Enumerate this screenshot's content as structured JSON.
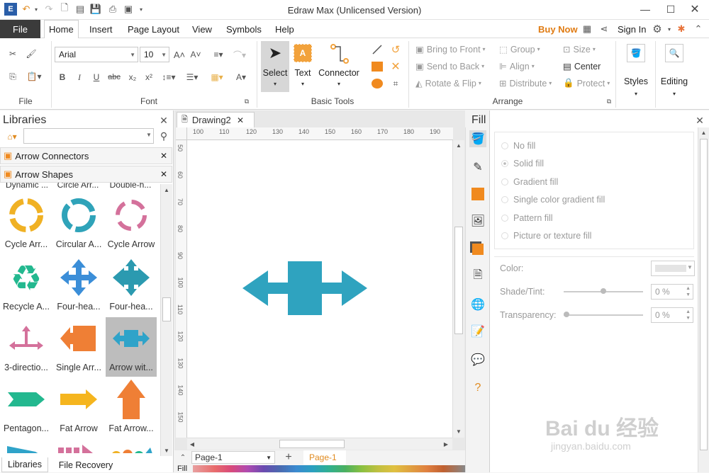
{
  "window": {
    "title": "Edraw Max (Unlicensed Version)"
  },
  "menu": {
    "file": "File",
    "tabs": [
      "Home",
      "Insert",
      "Page Layout",
      "View",
      "Symbols",
      "Help"
    ],
    "buy_now": "Buy Now",
    "sign_in": "Sign In"
  },
  "ribbon": {
    "file_group": "File",
    "font": {
      "name": "Arial",
      "size": "10",
      "group": "Font"
    },
    "basic_tools": {
      "select": "Select",
      "text": "Text",
      "connector": "Connector",
      "group": "Basic Tools"
    },
    "arrange": {
      "bring_to_front": "Bring to Front",
      "send_to_back": "Send to Back",
      "rotate_flip": "Rotate & Flip",
      "group": "Group",
      "align": "Align",
      "distribute": "Distribute",
      "size": "Size",
      "center": "Center",
      "protect": "Protect",
      "label": "Arrange"
    },
    "styles": "Styles",
    "editing": "Editing"
  },
  "libraries": {
    "title": "Libraries",
    "search_placeholder": "",
    "sections": [
      "Arrow Connectors",
      "Arrow Shapes"
    ],
    "cut_labels": [
      "Dynamic ...",
      "Circle Arr...",
      "Double-h..."
    ],
    "shapes": [
      {
        "label": "Cycle Arr...",
        "color": "#f0b124"
      },
      {
        "label": "Circular A...",
        "color": "#2fa3b9"
      },
      {
        "label": "Cycle Arrow",
        "color": "#d4719b"
      },
      {
        "label": "Recycle A...",
        "color": "#23b88f"
      },
      {
        "label": "Four-hea...",
        "color": "#3b8ed8"
      },
      {
        "label": "Four-hea...",
        "color": "#2b9ab0"
      },
      {
        "label": "3-directio...",
        "color": "#d4719b"
      },
      {
        "label": "Single Arr...",
        "color": "#ef7f35"
      },
      {
        "label": "Arrow wit...",
        "color": "#2fa3c9"
      },
      {
        "label": "Pentagon...",
        "color": "#23b88f"
      },
      {
        "label": "Fat Arrow",
        "color": "#f5b51e"
      },
      {
        "label": "Fat Arrow...",
        "color": "#ef7f35"
      }
    ]
  },
  "document": {
    "tab": "Drawing2",
    "hruler": [
      "100",
      "110",
      "120",
      "130",
      "140",
      "150",
      "160",
      "170",
      "180",
      "190"
    ],
    "vruler": [
      "50",
      "60",
      "70",
      "80",
      "90",
      "100",
      "110",
      "120",
      "130",
      "140",
      "150"
    ],
    "shape_color": "#2fa3bf"
  },
  "pages": {
    "selector": "Page-1",
    "active": "Page-1"
  },
  "bottom_tabs": {
    "libraries": "Libraries",
    "file_recovery": "File Recovery",
    "fill": "Fill"
  },
  "fill_panel": {
    "title": "Fill",
    "options": [
      "No fill",
      "Solid fill",
      "Gradient fill",
      "Single color gradient fill",
      "Pattern fill",
      "Picture or texture fill"
    ],
    "color_label": "Color:",
    "shade_label": "Shade/Tint:",
    "shade_value": "0 %",
    "transparency_label": "Transparency:",
    "transparency_value": "0 %"
  },
  "watermark": {
    "text": "Bai du 经验",
    "url": "jingyan.baidu.com"
  }
}
